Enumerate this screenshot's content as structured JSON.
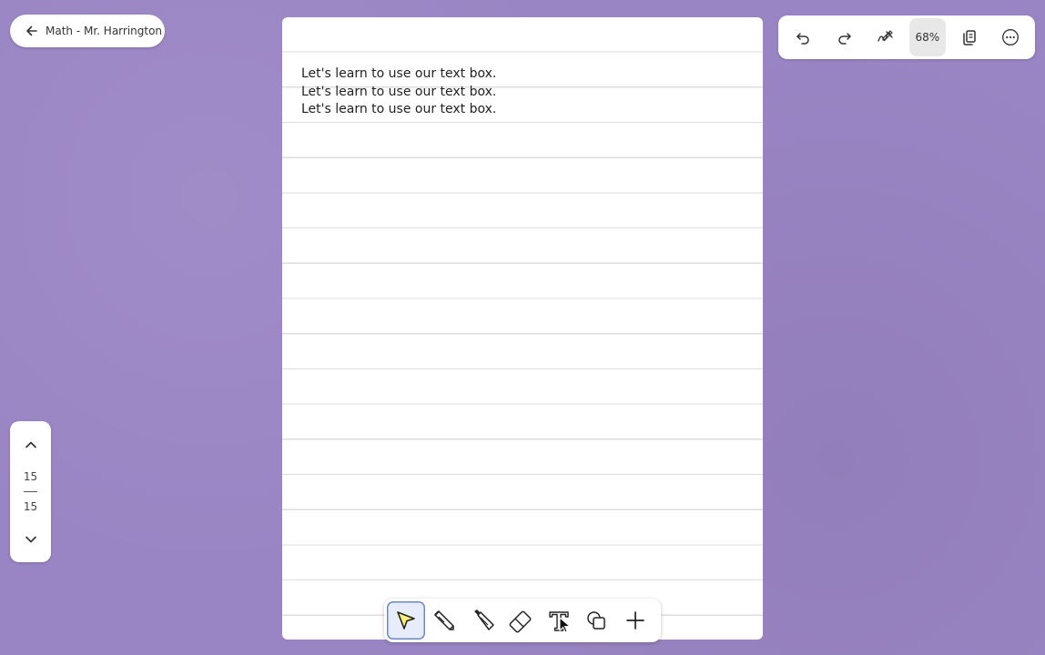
{
  "header": {
    "back_label": "Math - Mr. Harrington"
  },
  "toolbar": {
    "zoom_label": "68%",
    "icons": [
      "undo-icon",
      "redo-icon",
      "pen-off-icon",
      "zoom-level",
      "pages-icon",
      "more-icon"
    ]
  },
  "page_nav": {
    "current_page": "15",
    "total_pages": "15"
  },
  "document": {
    "lines": [
      "Let's learn to use our text box.",
      "Let's learn to use our text box.",
      "Let's learn to use our text box."
    ]
  },
  "tools": {
    "items": [
      "select-tool",
      "pencil-tool",
      "marker-tool",
      "eraser-tool",
      "text-tool",
      "shapes-tool",
      "add-tool"
    ],
    "active": "select-tool",
    "highlight_color": "#fff176",
    "active_border_color": "#6f86c4"
  },
  "colors": {
    "background": "#9a85c4",
    "surface": "#ffffff"
  }
}
